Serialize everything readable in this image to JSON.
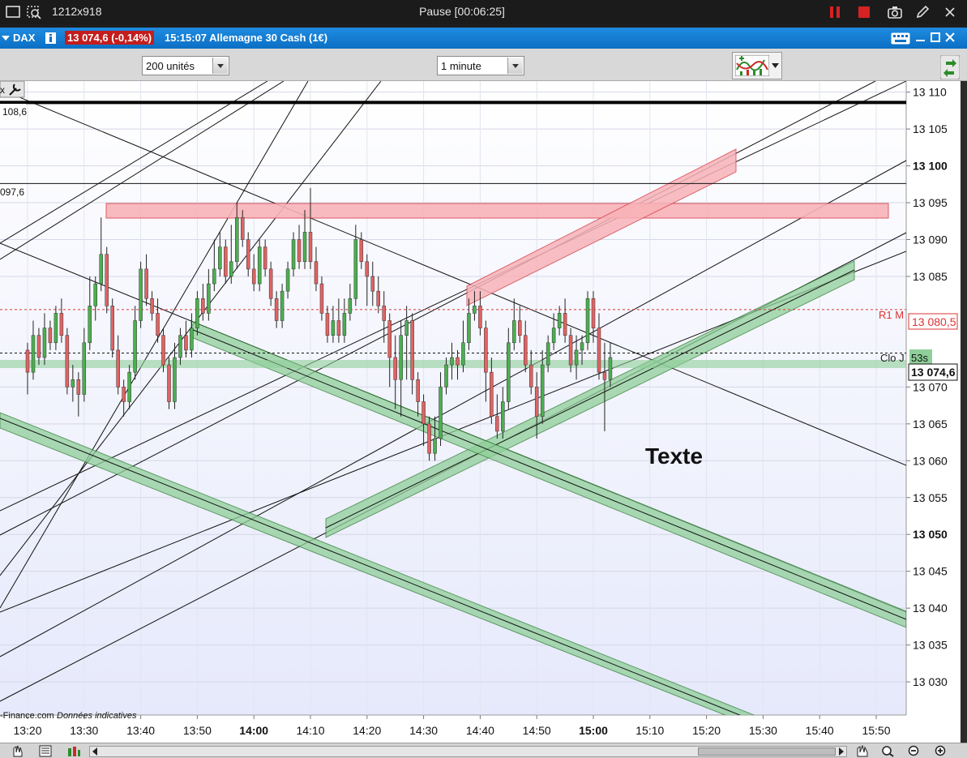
{
  "recorder": {
    "size_label": "1212x918",
    "status": "Pause [00:06:25]"
  },
  "window": {
    "ticker": "DAX",
    "price_badge": "13 074,6 (-0,14%)",
    "info": "15:15:07 Allemagne 30 Cash (1€)"
  },
  "toolbar": {
    "units_select": "200 unités",
    "interval_select": "1 minute"
  },
  "chart_data": {
    "type": "candlestick",
    "ylim": [
      13025.5,
      13111.5
    ],
    "y_ticks": [
      {
        "v": 13030,
        "label": "13 030",
        "bold": false
      },
      {
        "v": 13035,
        "label": "13 035",
        "bold": false
      },
      {
        "v": 13040,
        "label": "13 040",
        "bold": false
      },
      {
        "v": 13045,
        "label": "13 045",
        "bold": false
      },
      {
        "v": 13050,
        "label": "13 050",
        "bold": true
      },
      {
        "v": 13055,
        "label": "13 055",
        "bold": false
      },
      {
        "v": 13060,
        "label": "13 060",
        "bold": false
      },
      {
        "v": 13065,
        "label": "13 065",
        "bold": false
      },
      {
        "v": 13070,
        "label": "13 070",
        "bold": false
      },
      {
        "v": 13085,
        "label": "13 085",
        "bold": false
      },
      {
        "v": 13090,
        "label": "13 090",
        "bold": false
      },
      {
        "v": 13095,
        "label": "13 095",
        "bold": false
      },
      {
        "v": 13100,
        "label": "13 100",
        "bold": true
      },
      {
        "v": 13105,
        "label": "13 105",
        "bold": false
      },
      {
        "v": 13110,
        "label": "13 110",
        "bold": false
      }
    ],
    "x_ticks": [
      {
        "t": 0,
        "label": "13:20",
        "bold": false
      },
      {
        "t": 10,
        "label": "13:30",
        "bold": false
      },
      {
        "t": 20,
        "label": "13:40",
        "bold": false
      },
      {
        "t": 30,
        "label": "13:50",
        "bold": false
      },
      {
        "t": 40,
        "label": "14:00",
        "bold": true
      },
      {
        "t": 50,
        "label": "14:10",
        "bold": false
      },
      {
        "t": 60,
        "label": "14:20",
        "bold": false
      },
      {
        "t": 70,
        "label": "14:30",
        "bold": false
      },
      {
        "t": 80,
        "label": "14:40",
        "bold": false
      },
      {
        "t": 90,
        "label": "14:50",
        "bold": false
      },
      {
        "t": 100,
        "label": "15:00",
        "bold": true
      },
      {
        "t": 110,
        "label": "15:10",
        "bold": false
      },
      {
        "t": 120,
        "label": "15:20",
        "bold": false
      },
      {
        "t": 130,
        "label": "15:30",
        "bold": false
      },
      {
        "t": 140,
        "label": "15:40",
        "bold": false
      },
      {
        "t": 150,
        "label": "15:50",
        "bold": false
      }
    ],
    "x_first_time": "13:20",
    "candles": [
      [
        13075,
        13072,
        13069,
        13076
      ],
      [
        13072,
        13077,
        13071,
        13079
      ],
      [
        13077,
        13074,
        13073,
        13078
      ],
      [
        13074,
        13078,
        13073,
        13080
      ],
      [
        13078,
        13076,
        13075,
        13079
      ],
      [
        13076,
        13080,
        13075,
        13081
      ],
      [
        13080,
        13077,
        13076,
        13082
      ],
      [
        13077,
        13070,
        13069,
        13078
      ],
      [
        13070,
        13071,
        13068,
        13073
      ],
      [
        13071,
        13069,
        13066,
        13072
      ],
      [
        13069,
        13076,
        13068,
        13078
      ],
      [
        13076,
        13081,
        13075,
        13085
      ],
      [
        13081,
        13084,
        13079,
        13085
      ],
      [
        13084,
        13088,
        13083,
        13093
      ],
      [
        13088,
        13081,
        13080,
        13089
      ],
      [
        13081,
        13075,
        13074,
        13082
      ],
      [
        13075,
        13070,
        13069,
        13077
      ],
      [
        13070,
        13068,
        13066,
        13071
      ],
      [
        13068,
        13072,
        13067,
        13073
      ],
      [
        13072,
        13079,
        13071,
        13081
      ],
      [
        13079,
        13086,
        13078,
        13087
      ],
      [
        13086,
        13082,
        13081,
        13088
      ],
      [
        13082,
        13080,
        13079,
        13083
      ],
      [
        13080,
        13077,
        13076,
        13082
      ],
      [
        13077,
        13073,
        13072,
        13078
      ],
      [
        13073,
        13068,
        13067,
        13074
      ],
      [
        13068,
        13074,
        13067,
        13076
      ],
      [
        13074,
        13077,
        13073,
        13078
      ],
      [
        13077,
        13075,
        13074,
        13079
      ],
      [
        13075,
        13078,
        13074,
        13080
      ],
      [
        13078,
        13082,
        13077,
        13083
      ],
      [
        13082,
        13080,
        13079,
        13084
      ],
      [
        13080,
        13084,
        13079,
        13086
      ],
      [
        13084,
        13086,
        13083,
        13090
      ],
      [
        13086,
        13089,
        13085,
        13091
      ],
      [
        13089,
        13085,
        13084,
        13090
      ],
      [
        13085,
        13087,
        13084,
        13092
      ],
      [
        13087,
        13093,
        13086,
        13095
      ],
      [
        13093,
        13090,
        13089,
        13094
      ],
      [
        13090,
        13086,
        13085,
        13091
      ],
      [
        13086,
        13084,
        13083,
        13088
      ],
      [
        13084,
        13089,
        13083,
        13090
      ],
      [
        13089,
        13086,
        13085,
        13090
      ],
      [
        13086,
        13082,
        13081,
        13087
      ],
      [
        13082,
        13079,
        13078,
        13083
      ],
      [
        13079,
        13083,
        13078,
        13084
      ],
      [
        13083,
        13086,
        13082,
        13087
      ],
      [
        13086,
        13090,
        13085,
        13091
      ],
      [
        13090,
        13087,
        13086,
        13092
      ],
      [
        13087,
        13091,
        13086,
        13094
      ],
      [
        13091,
        13087,
        13086,
        13097
      ],
      [
        13087,
        13084,
        13083,
        13089
      ],
      [
        13084,
        13080,
        13079,
        13085
      ],
      [
        13080,
        13077,
        13076,
        13081
      ],
      [
        13077,
        13079,
        13076,
        13081
      ],
      [
        13079,
        13077,
        13076,
        13082
      ],
      [
        13077,
        13080,
        13076,
        13082
      ],
      [
        13080,
        13082,
        13079,
        13084
      ],
      [
        13082,
        13090,
        13081,
        13092
      ],
      [
        13090,
        13087,
        13086,
        13091
      ],
      [
        13087,
        13085,
        13081,
        13088
      ],
      [
        13085,
        13083,
        13081,
        13087
      ],
      [
        13083,
        13081,
        13080,
        13085
      ],
      [
        13081,
        13079,
        13076,
        13083
      ],
      [
        13079,
        13074,
        13070,
        13080
      ],
      [
        13074,
        13071,
        13067,
        13077
      ],
      [
        13071,
        13077,
        13066,
        13079
      ],
      [
        13077,
        13079,
        13071,
        13081
      ],
      [
        13079,
        13071,
        13069,
        13080
      ],
      [
        13071,
        13068,
        13066,
        13072
      ],
      [
        13068,
        13065,
        13062,
        13069
      ],
      [
        13065,
        13061,
        13060,
        13066
      ],
      [
        13061,
        13063,
        13060,
        13066
      ],
      [
        13063,
        13070,
        13062,
        13072
      ],
      [
        13070,
        13073,
        13069,
        13074
      ],
      [
        13073,
        13074,
        13071,
        13076
      ],
      [
        13074,
        13073,
        13071,
        13075
      ],
      [
        13073,
        13076,
        13072,
        13079
      ],
      [
        13076,
        13080,
        13075,
        13082
      ],
      [
        13080,
        13081,
        13079,
        13083
      ],
      [
        13081,
        13078,
        13077,
        13083
      ],
      [
        13078,
        13072,
        13068,
        13079
      ],
      [
        13072,
        13066,
        13065,
        13074
      ],
      [
        13066,
        13064,
        13063,
        13069
      ],
      [
        13064,
        13068,
        13063,
        13070
      ],
      [
        13068,
        13076,
        13067,
        13078
      ],
      [
        13076,
        13079,
        13075,
        13082
      ],
      [
        13079,
        13077,
        13076,
        13081
      ],
      [
        13077,
        13073,
        13072,
        13079
      ],
      [
        13073,
        13070,
        13069,
        13075
      ],
      [
        13070,
        13066,
        13063,
        13072
      ],
      [
        13066,
        13073,
        13065,
        13075
      ],
      [
        13073,
        13076,
        13072,
        13077
      ],
      [
        13076,
        13078,
        13075,
        13080
      ],
      [
        13078,
        13080,
        13077,
        13081
      ],
      [
        13080,
        13077,
        13076,
        13082
      ],
      [
        13077,
        13073,
        13072,
        13078
      ],
      [
        13073,
        13075,
        13071,
        13077
      ],
      [
        13075,
        13076,
        13073,
        13077
      ],
      [
        13076,
        13082,
        13075,
        13083
      ],
      [
        13082,
        13078,
        13076,
        13083
      ],
      [
        13078,
        13072,
        13071,
        13080
      ],
      [
        13072,
        13071,
        13064,
        13076
      ],
      [
        13071,
        13074,
        13070,
        13076
      ]
    ],
    "levels": [
      {
        "v": 13108.6,
        "label": "108,6",
        "style": "thick"
      },
      {
        "v": 13097.6,
        "label": "097,6",
        "style": "thin"
      },
      {
        "v": 13080.5,
        "label": "R1 M",
        "value_tag": "13 080,5",
        "style": "red-dashed"
      },
      {
        "v": 13074.6,
        "label": "Clo J",
        "value_tag": "13 074,6",
        "style": "dashed"
      }
    ],
    "countdown": "53s",
    "text_annotation": "Texte",
    "footer_text": "-Finance.com",
    "footer_note": "Données indicatives",
    "colors": {
      "up_candle": "#4caf50",
      "down_candle": "#e06363",
      "red_zone": "#f8b3b8",
      "green_channel": "#8fcf99",
      "chart_bg_top": "#ffffff",
      "chart_bg_bottom": "#e6e9fb"
    }
  }
}
